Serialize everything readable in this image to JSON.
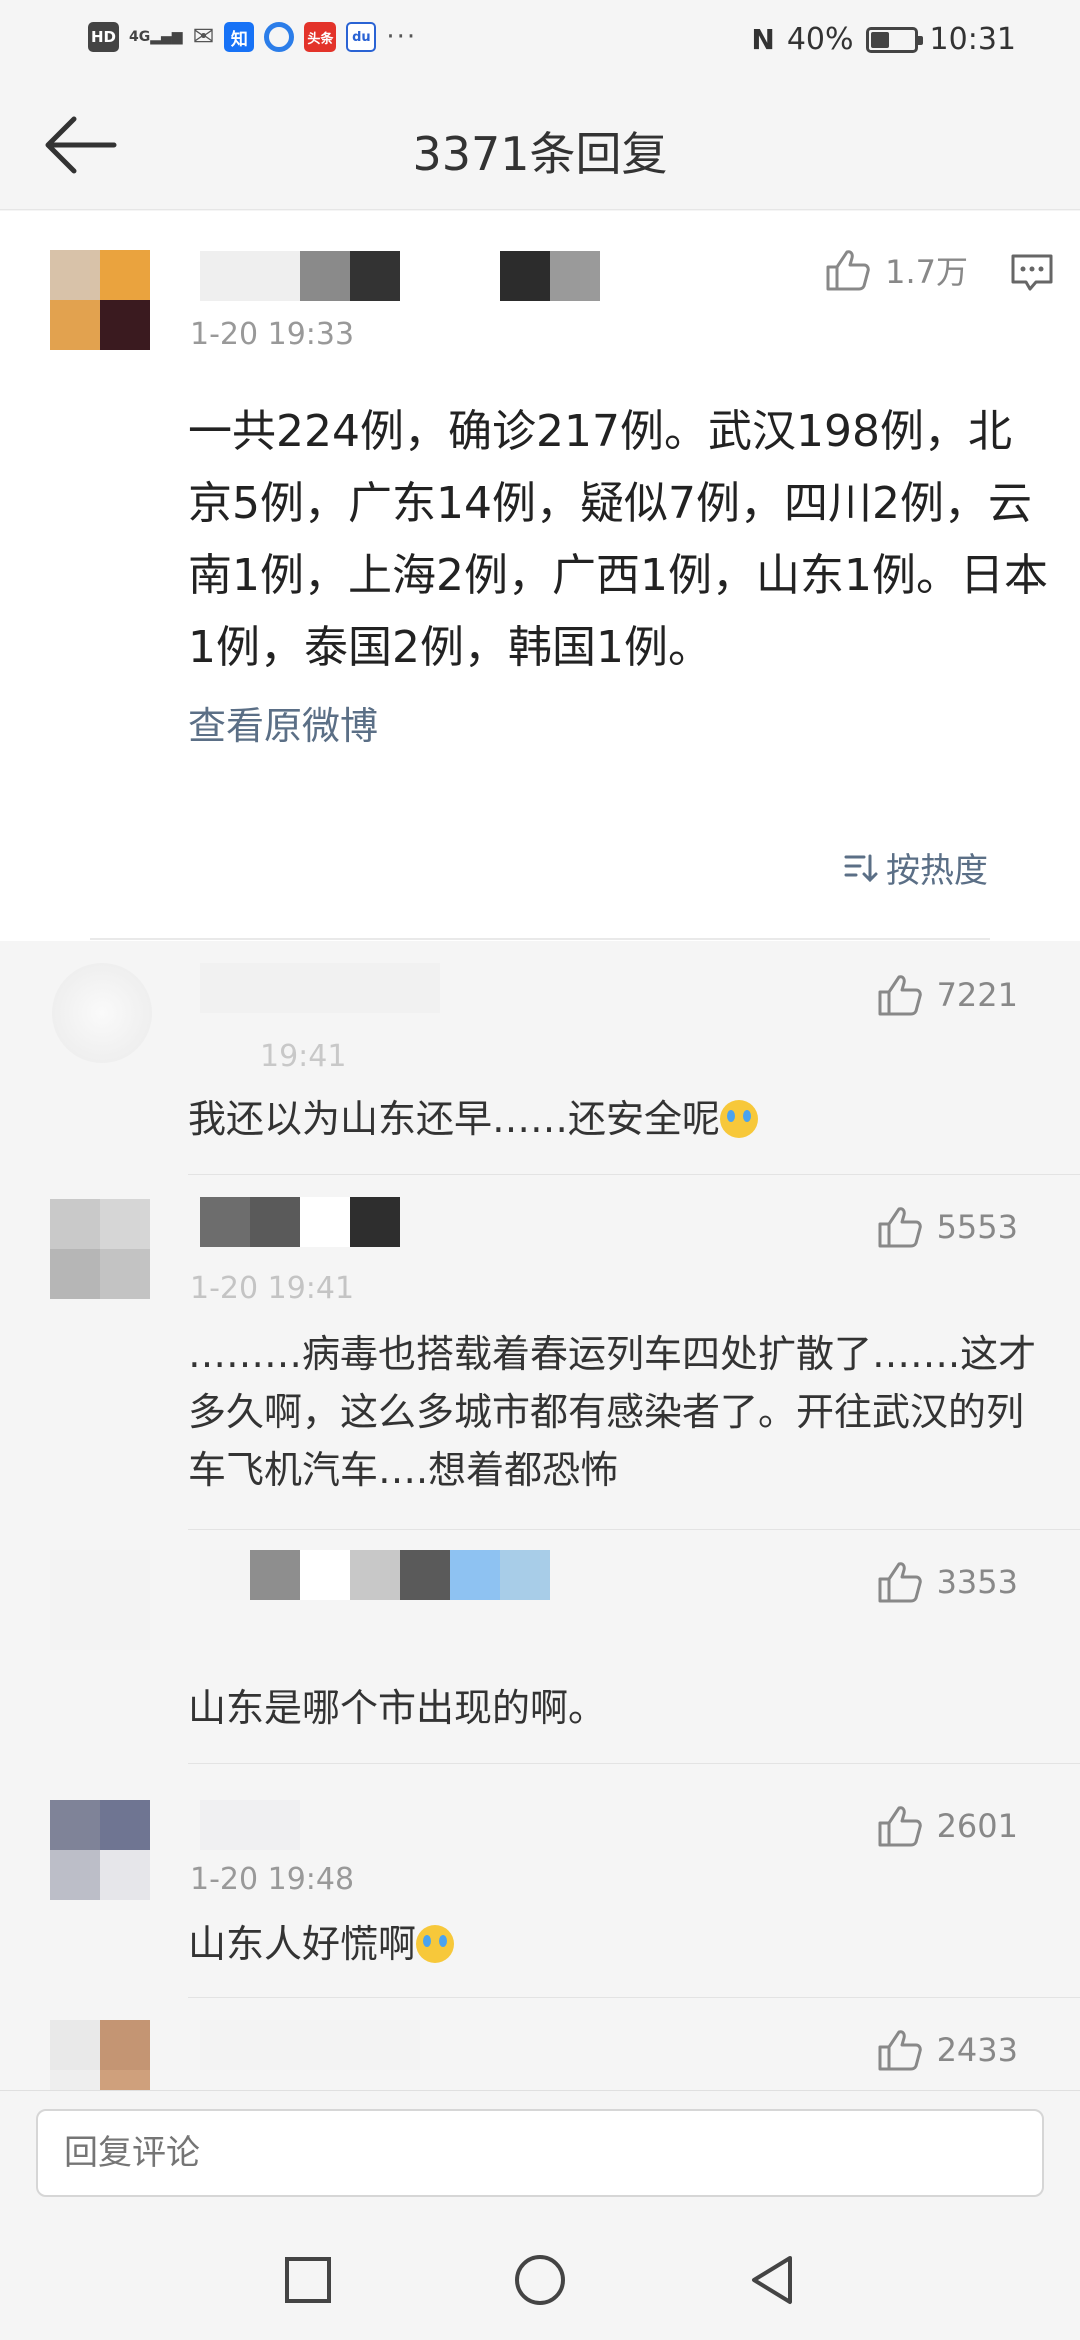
{
  "status_bar": {
    "hd": "HD",
    "signal": "4G",
    "zhihu": "知",
    "toutiao": "头条",
    "baidu": "du",
    "more": "···",
    "nfc": "N",
    "battery": "40%",
    "battery_level": 0.4,
    "time": "10:31"
  },
  "header": {
    "title": "3371条回复"
  },
  "main_comment": {
    "time": "1-20 19:33",
    "likes": "1.7万",
    "text": "一共224例，确诊217例。武汉198例，北京5例，广东14例，疑似7例，四川2例，云南1例，上海2例，广西1例，山东1例。日本1例，泰国2例，韩国1例。",
    "view_original": "查看原微博",
    "sort_label": "按热度",
    "avatar_colors": [
      "#d8c2a9",
      "#eaa33e",
      "#e2a24f",
      "#3a1a1f"
    ]
  },
  "replies": [
    {
      "time": "19:41",
      "likes": "7221",
      "text": "我还以为山东还早……还安全呢",
      "has_emoji": true
    },
    {
      "time": "1-20 19:41",
      "likes": "5553",
      "text": "………病毒也搭载着春运列车四处扩散了…….这才多久啊，这么多城市都有感染者了。开往武汉的列车飞机汽车….想着都恐怖",
      "has_emoji": false
    },
    {
      "time": "",
      "likes": "3353",
      "text": "山东是哪个市出现的啊。",
      "has_emoji": false
    },
    {
      "time": "1-20 19:48",
      "likes": "2601",
      "text": "山东人好慌啊",
      "has_emoji": true
    },
    {
      "time": "",
      "likes": "2433",
      "text": "",
      "has_emoji": false
    }
  ],
  "input_bar": {
    "placeholder": "回复评论"
  }
}
